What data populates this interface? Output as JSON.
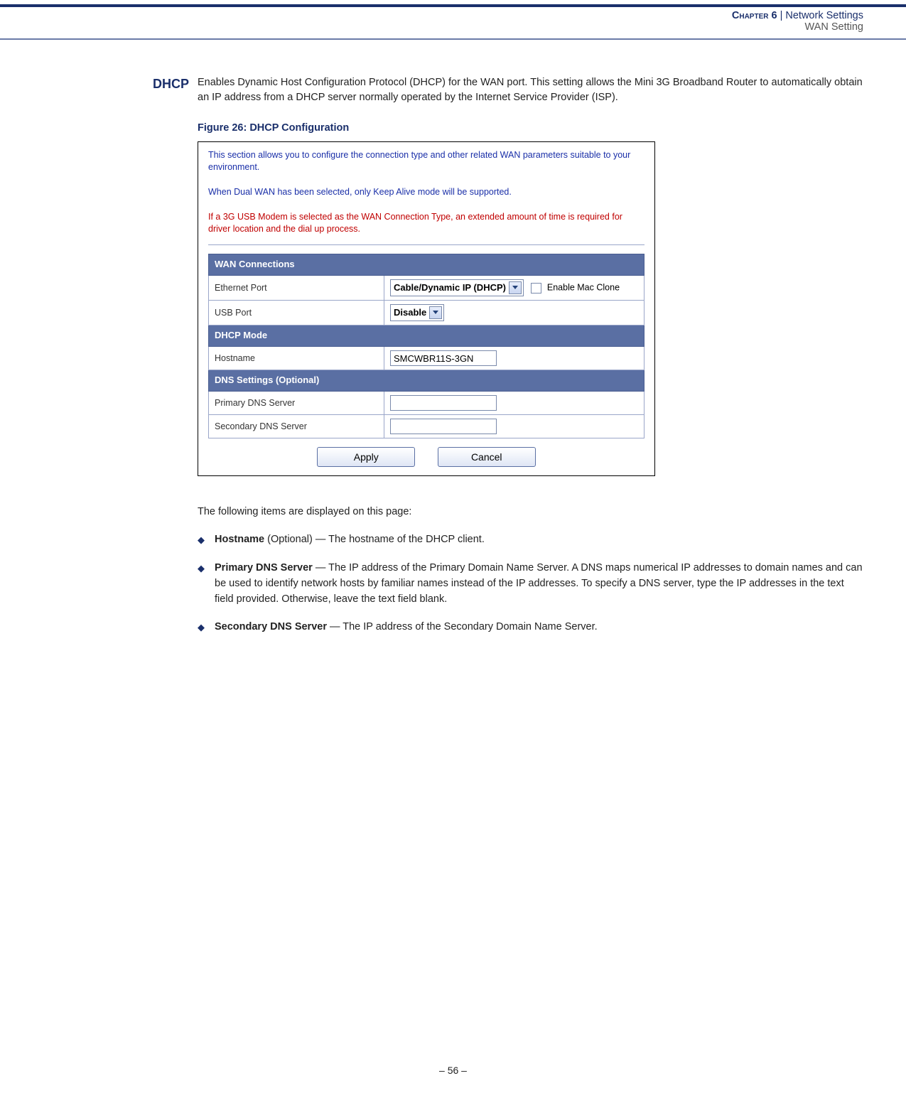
{
  "header": {
    "chapter_label": "Chapter 6",
    "separator": "  |  ",
    "chapter_title": "Network Settings",
    "section_title": "WAN Setting"
  },
  "gutter": {
    "section_label": "DHCP"
  },
  "intro": "Enables Dynamic Host Configuration Protocol (DHCP) for the WAN port. This setting allows the Mini 3G Broadband Router to automatically obtain an IP address from a DHCP server normally operated by the Internet Service Provider (ISP).",
  "figure_caption": "Figure 26:  DHCP Configuration",
  "screenshot": {
    "note1": "This section allows you to configure the connection type and other related WAN parameters suitable to your environment.",
    "note2": "When Dual WAN has been selected, only Keep Alive mode will be supported.",
    "note3": "If a 3G USB Modem is selected as the WAN Connection Type, an extended amount of time is required for driver location and the dial up process.",
    "sections": {
      "wan_conn": {
        "header": "WAN Connections",
        "rows": {
          "ethernet": {
            "label": "Ethernet Port",
            "select_value": "Cable/Dynamic IP (DHCP)",
            "checkbox_label": "Enable Mac Clone"
          },
          "usb": {
            "label": "USB Port",
            "select_value": "Disable"
          }
        }
      },
      "dhcp_mode": {
        "header": "DHCP Mode",
        "rows": {
          "hostname": {
            "label": "Hostname",
            "value": "SMCWBR11S-3GN"
          }
        }
      },
      "dns": {
        "header": "DNS Settings (Optional)",
        "rows": {
          "primary": {
            "label": "Primary DNS Server",
            "value": ""
          },
          "secondary": {
            "label": "Secondary DNS Server",
            "value": ""
          }
        }
      }
    },
    "buttons": {
      "apply": "Apply",
      "cancel": "Cancel"
    }
  },
  "followup": "The following items are displayed on this page:",
  "bullets": [
    {
      "term": "Hostname",
      "after_term": " (Optional) — The hostname of the DHCP client."
    },
    {
      "term": "Primary DNS Server",
      "after_term": " — The IP address of the Primary Domain Name Server. A DNS maps numerical IP addresses to domain names and can be used to identify network hosts by familiar names instead of the IP addresses. To specify a DNS server, type the IP addresses in the text field provided. Otherwise, leave the text field blank."
    },
    {
      "term": "Secondary DNS Server",
      "after_term": " — The IP address of the Secondary Domain Name Server."
    }
  ],
  "footer": "–  56  –"
}
